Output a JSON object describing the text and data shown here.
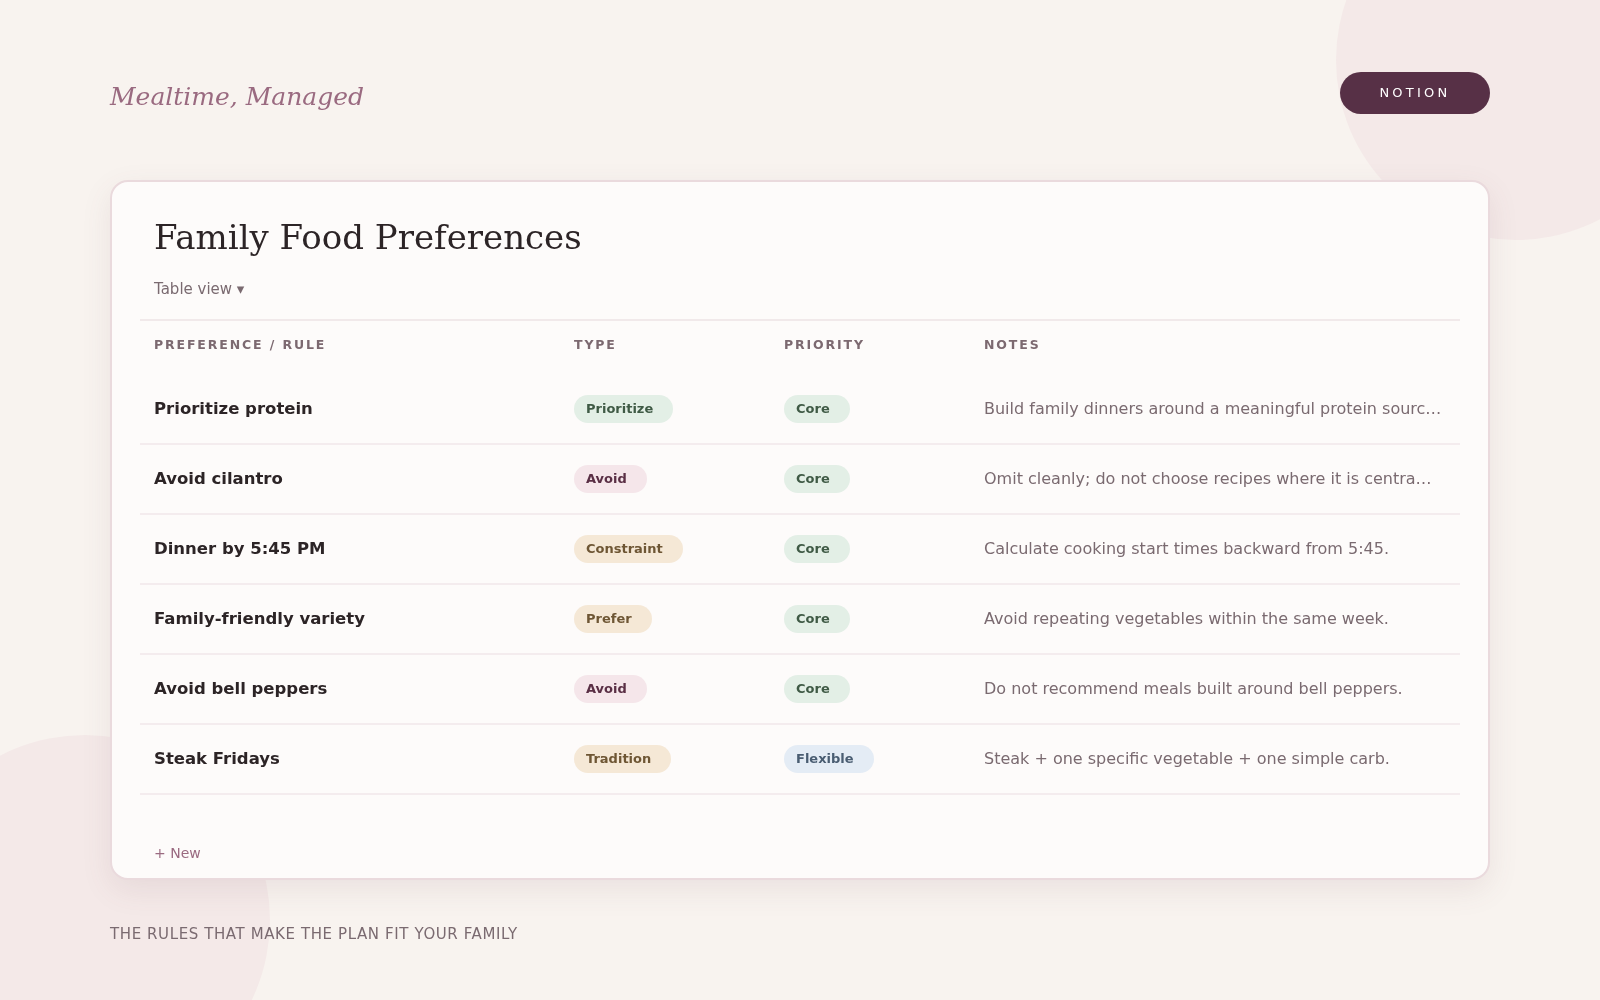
{
  "brand": "Mealtime, Managed",
  "header_button": "NOTION",
  "card": {
    "title": "Family Food Preferences",
    "view_switcher": "Table view ▾",
    "table": {
      "columns": [
        "PREFERENCE / RULE",
        "TYPE",
        "PRIORITY",
        "NOTES"
      ],
      "rows": [
        {
          "name": "Prioritize protein",
          "type": {
            "label": "Prioritize",
            "kind": "green"
          },
          "priority": {
            "label": "Core",
            "kind": "green"
          },
          "notes": "Build family dinners around a meaningful protein sourc…"
        },
        {
          "name": "Avoid cilantro",
          "type": {
            "label": "Avoid",
            "kind": "rose"
          },
          "priority": {
            "label": "Core",
            "kind": "green"
          },
          "notes": "Omit cleanly; do not choose recipes where it is centra…"
        },
        {
          "name": "Dinner by 5:45 PM",
          "type": {
            "label": "Constraint",
            "kind": "sand"
          },
          "priority": {
            "label": "Core",
            "kind": "green"
          },
          "notes": "Calculate cooking start times backward from 5:45."
        },
        {
          "name": "Family-friendly variety",
          "type": {
            "label": "Prefer",
            "kind": "sand"
          },
          "priority": {
            "label": "Core",
            "kind": "green"
          },
          "notes": "Avoid repeating vegetables within the same week."
        },
        {
          "name": "Avoid bell peppers",
          "type": {
            "label": "Avoid",
            "kind": "rose"
          },
          "priority": {
            "label": "Core",
            "kind": "green"
          },
          "notes": "Do not recommend meals built around bell peppers."
        },
        {
          "name": "Steak Fridays",
          "type": {
            "label": "Tradition",
            "kind": "sand"
          },
          "priority": {
            "label": "Flexible",
            "kind": "blue"
          },
          "notes": "Steak + one specific vegetable + one simple carb."
        }
      ]
    },
    "new_button": "+ New"
  },
  "footer": "THE RULES THAT MAKE THE PLAN FIT YOUR FAMILY"
}
